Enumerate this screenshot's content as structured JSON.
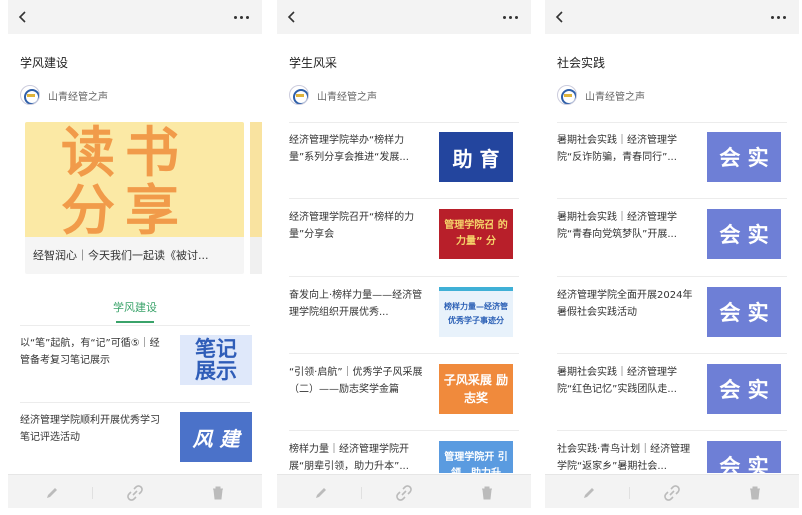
{
  "colors": {
    "accent_green": "#3aa36a",
    "topbar": "#f3f3f3",
    "thumb_blue": "#6e7fd6",
    "thumb_red": "#b81f2a",
    "thumb_orange": "#f08a3c",
    "banner_yellow": "#fbe9a5"
  },
  "icons": {
    "back": "chevron-left-icon",
    "more": "more-dots-icon",
    "edit": "pencil-icon",
    "link": "link-icon",
    "delete": "trash-icon"
  },
  "panels": [
    {
      "title": "学风建设",
      "account": "山青经管之声",
      "banner": {
        "text_top": "读书",
        "text_bottom": "分享",
        "caption": "经智润心｜今天我们一起读《被讨..."
      },
      "tab_label": "学风建设",
      "items": [
        {
          "text": "以“笔”起航，有“记”可循⑤｜经管备考复习笔记展示",
          "thumb_text": "笔记展示"
        },
        {
          "text": "经济管理学院顺利开展优秀学习笔记评选活动",
          "thumb_text": "风 建"
        }
      ]
    },
    {
      "title": "学生风采",
      "account": "山青经管之声",
      "items": [
        {
          "text": "经济管理学院举办“榜样力量”系列分享会推进“发展...",
          "thumb_text": "助 育"
        },
        {
          "text": "经济管理学院召开“榜样的力量”分享会",
          "thumb_text": "管理学院召 的力量” 分"
        },
        {
          "text": "奋发向上·榜样力量——经济管理学院组织开展优秀...",
          "thumb_text": "榜样力量—经济管 优秀学子事迹分"
        },
        {
          "text": "“引领·启航”｜优秀学子风采展（二）——励志奖学金篇",
          "thumb_text": "子风采展 励志奖"
        },
        {
          "text": "榜样力量｜经济管理学院开展“朋辈引领，助力升本”...",
          "thumb_text": "管理学院开 引领，助力升"
        }
      ]
    },
    {
      "title": "社会实践",
      "account": "山青经管之声",
      "items": [
        {
          "text": "暑期社会实践｜经济管理学院“反诈防骗，青春同行”...",
          "thumb_text": "会 实"
        },
        {
          "text": "暑期社会实践｜经济管理学院“青春向党筑梦队”开展...",
          "thumb_text": "会 实"
        },
        {
          "text": "经济管理学院全面开展2024年暑假社会实践活动",
          "thumb_text": "会 实"
        },
        {
          "text": "暑期社会实践｜经济管理学院“红色记忆”实践团队走...",
          "thumb_text": "会 实"
        },
        {
          "text": "社会实践·青鸟计划｜经济管理学院“返家乡”暑期社会...",
          "thumb_text": "会 实"
        }
      ]
    }
  ]
}
